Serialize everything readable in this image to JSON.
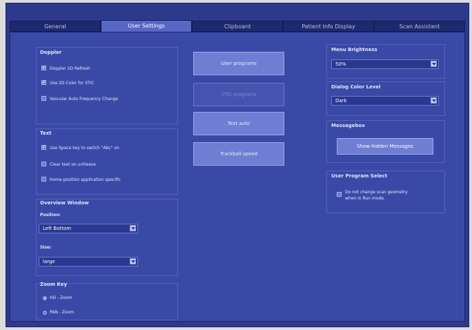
{
  "tabs": [
    {
      "label": "General"
    },
    {
      "label": "User Settings"
    },
    {
      "label": "Clipboard"
    },
    {
      "label": "Patient Info Display"
    },
    {
      "label": "Scan Assistant"
    }
  ],
  "doppler": {
    "title": "Doppler",
    "items": [
      {
        "label": "Doppler 2D Refresh",
        "checked": true
      },
      {
        "label": "Use 2D Color for STIC",
        "checked": true
      },
      {
        "label": "Vascular Auto Frequency Change",
        "checked": false
      }
    ]
  },
  "text": {
    "title": "Text",
    "items": [
      {
        "label": "Use Space key to switch \"Abc\" on",
        "checked": true
      },
      {
        "label": "Clear text on unfreeze",
        "checked": false
      },
      {
        "label": "Home position application specific",
        "checked": false
      }
    ]
  },
  "overview": {
    "title": "Overview Window",
    "position_label": "Position:",
    "position_value": "Left Bottom",
    "size_label": "Size:",
    "size_value": "large"
  },
  "zoom": {
    "title": "Zoom Key",
    "options": [
      {
        "label": "HD - Zoom",
        "selected": true
      },
      {
        "label": "PAN - Zoom",
        "selected": false
      }
    ]
  },
  "buttons": {
    "user_programs": "User programs",
    "stic_programs": "STIC programs",
    "text_auto": "Text auto",
    "trackball_speed": "Trackball speed"
  },
  "menu_brightness": {
    "title": "Menu Brightness",
    "value": "50%"
  },
  "dialog_color": {
    "title": "Dialog Color Level",
    "value": "Dark"
  },
  "messagebox": {
    "title": "Messagebox",
    "button": "Show hidden Messages"
  },
  "user_program_select": {
    "title": "User Program Select",
    "line1": "Do not change scan geometry",
    "line2": "when in Run mode."
  }
}
